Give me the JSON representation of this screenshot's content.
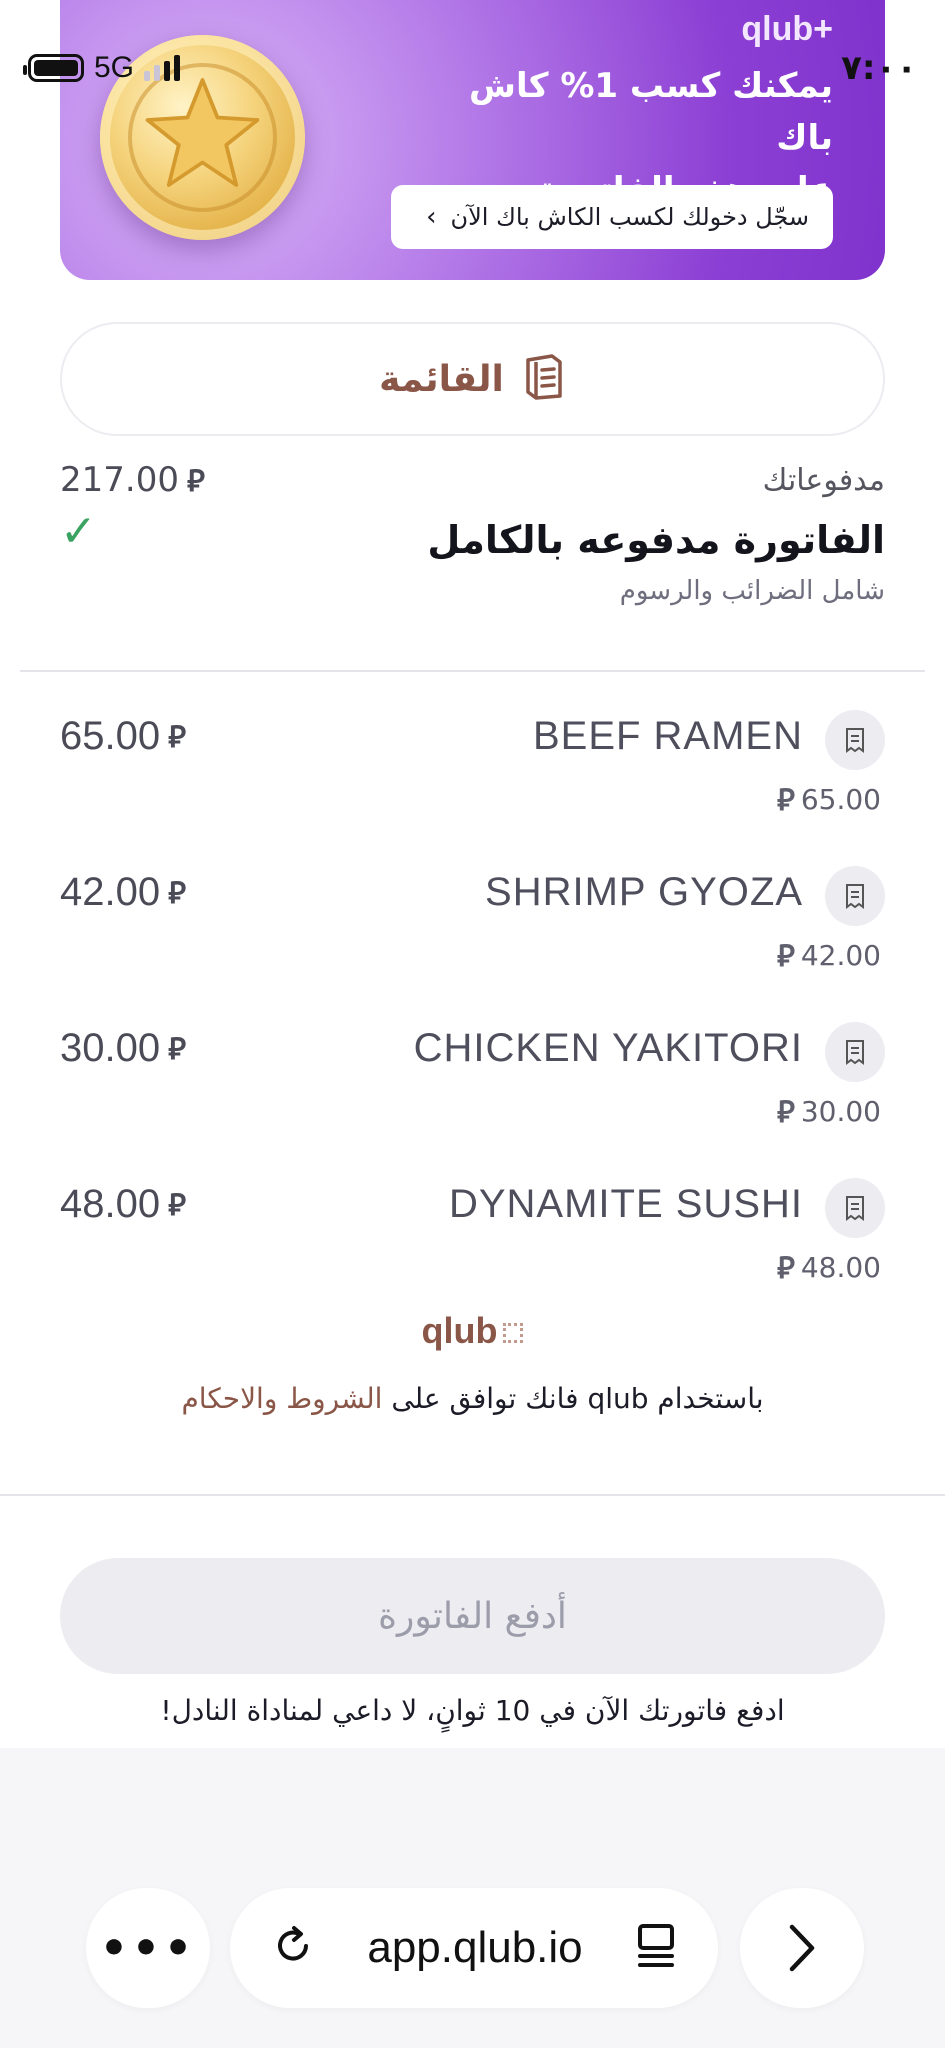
{
  "status_bar": {
    "network": "5G",
    "time": "٧:٠٠"
  },
  "promo": {
    "brand": "qlub+",
    "title_line1": "يمكنك كسب 1% كاش باك",
    "title_line2": "على هذه الفاتورة",
    "cta": "سجّل دخولك لكسب الكاش باك الآن",
    "cta_chevron": "›"
  },
  "menu": {
    "label": "القائمة"
  },
  "payments": {
    "label": "مدفوعاتك",
    "amount": "217.00",
    "currency": "⃁",
    "status": "الفاتورة مدفوعه بالكامل",
    "check": "✓",
    "tax_note": "شامل الضرائب والرسوم"
  },
  "items": [
    {
      "name": "BEEF RAMEN",
      "unit_price": "65.00",
      "total": "65.00"
    },
    {
      "name": "SHRIMP GYOZA",
      "unit_price": "42.00",
      "total": "42.00"
    },
    {
      "name": "CHICKEN YAKITORI",
      "unit_price": "30.00",
      "total": "30.00"
    },
    {
      "name": "DYNAMITE SUSHI",
      "unit_price": "48.00",
      "total": "48.00"
    }
  ],
  "footer": {
    "logo": "qlub",
    "terms_prefix": "باستخدام qlub فانك توافق على",
    "terms_link": "الشروط والاحكام"
  },
  "pay": {
    "button": "أدفع الفاتورة",
    "hint": "ادفع فاتورتك الآن في 10 ثوانٍ، لا داعي لمناداة النادل!"
  },
  "browser": {
    "more": "•••",
    "url": "app.qlub.io"
  },
  "colors": {
    "accent": "#8a5648",
    "promo_purple": "#8c3fd4",
    "check_green": "#3aa361"
  }
}
